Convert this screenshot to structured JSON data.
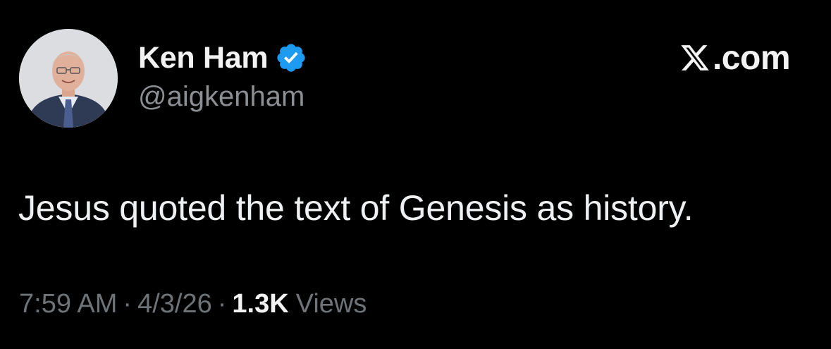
{
  "author": {
    "display_name": "Ken Ham",
    "handle": "@aigkenham",
    "verified": true,
    "avatar_icon": "profile-photo-avatar"
  },
  "brand": {
    "label": ".com",
    "logo_icon": "x-logo-icon"
  },
  "tweet": {
    "text": "Jesus quoted the text of Genesis as history."
  },
  "meta": {
    "time": "7:59 AM",
    "separator": "·",
    "date": "4/3/26",
    "views_count": "1.3K",
    "views_label": "Views"
  },
  "colors": {
    "background": "#000000",
    "verified_blue": "#1d9bf0",
    "secondary_text": "#6e7378",
    "primary_text": "#e7e9ea"
  }
}
